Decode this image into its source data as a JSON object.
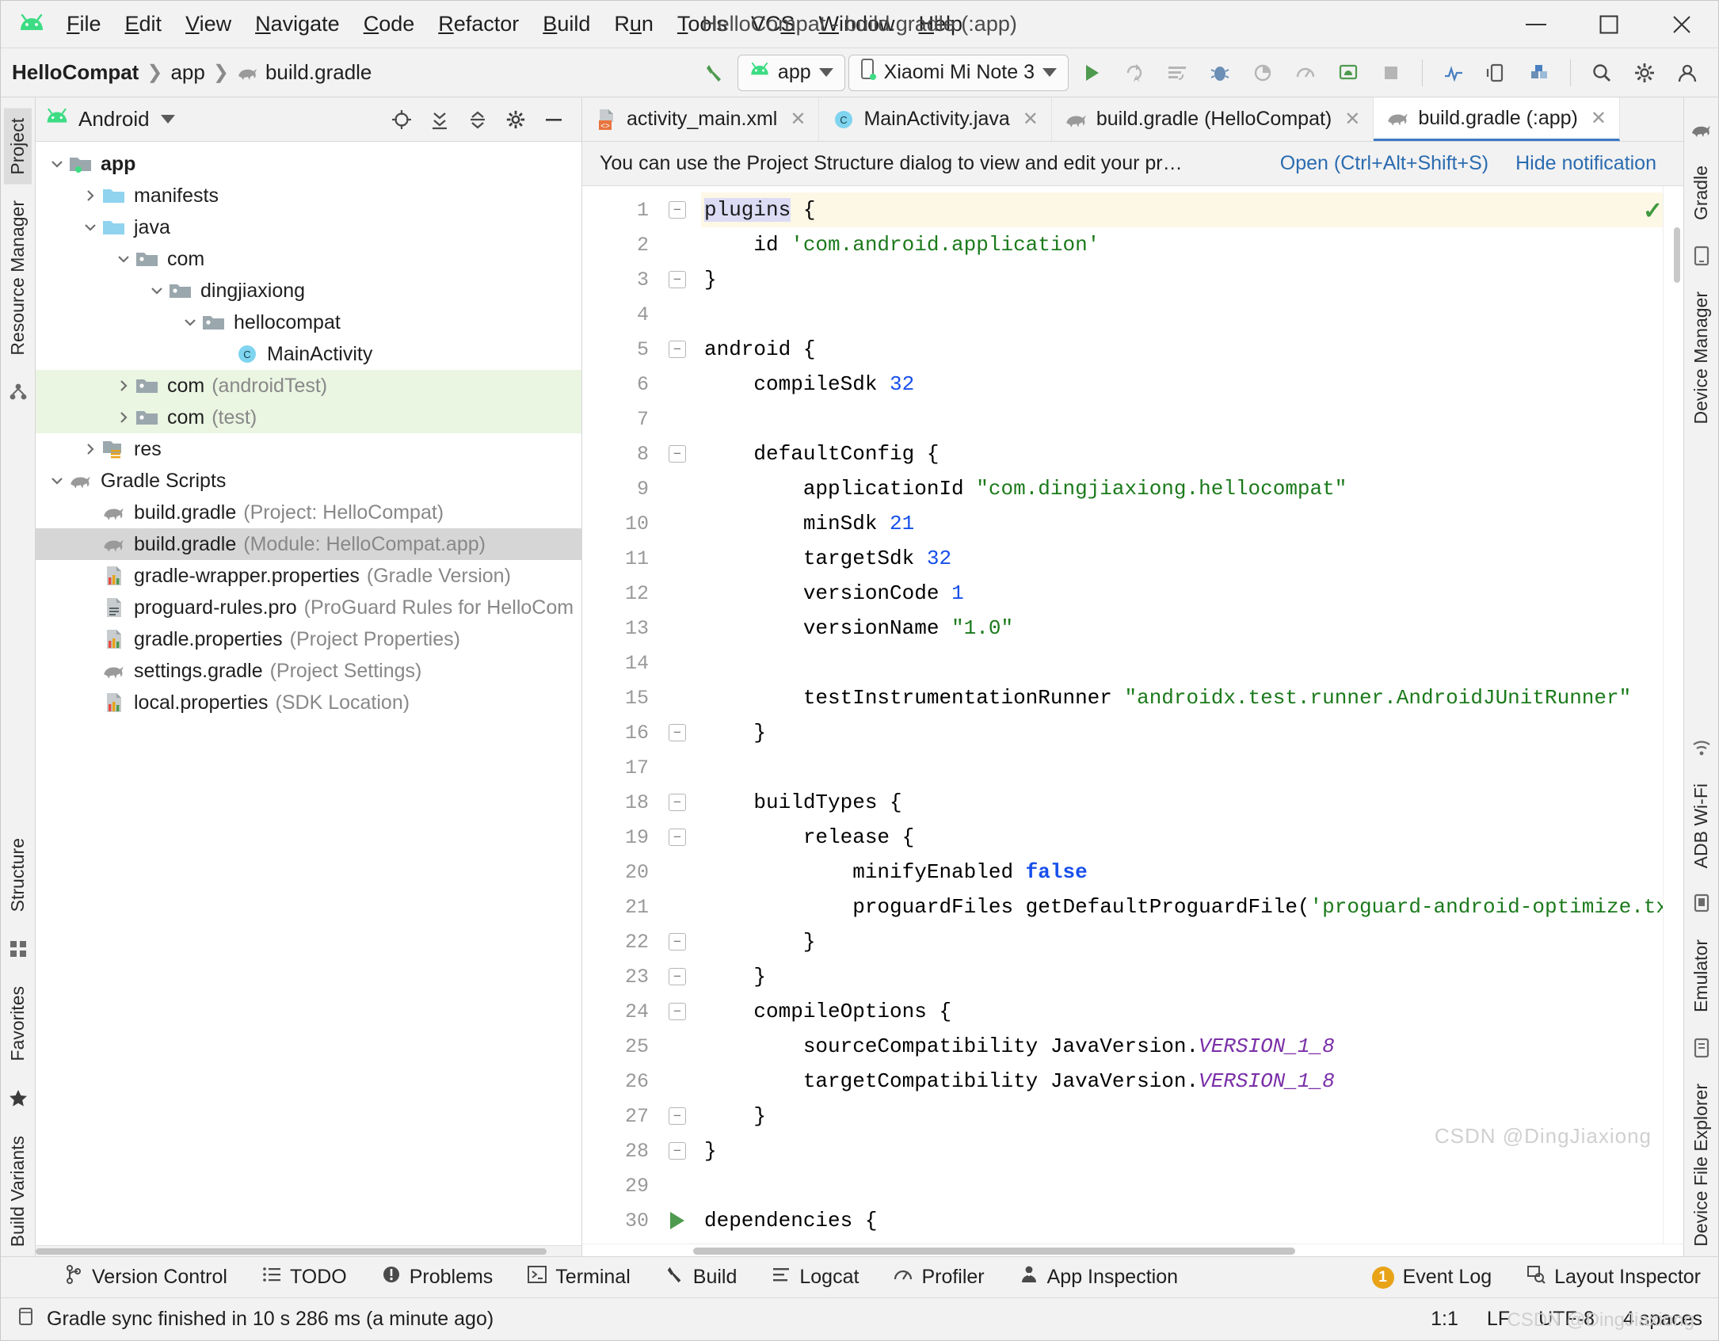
{
  "window": {
    "title": "HelloCompat - build.gradle (:app)",
    "minimize": "–",
    "maximize": "☐",
    "close": "✕"
  },
  "menu": {
    "items": [
      {
        "label": "File",
        "mnemonic": "F"
      },
      {
        "label": "Edit",
        "mnemonic": "E"
      },
      {
        "label": "View",
        "mnemonic": "V"
      },
      {
        "label": "Navigate",
        "mnemonic": "N"
      },
      {
        "label": "Code",
        "mnemonic": "C"
      },
      {
        "label": "Refactor",
        "mnemonic": "R"
      },
      {
        "label": "Build",
        "mnemonic": "B"
      },
      {
        "label": "Run",
        "mnemonic": "u"
      },
      {
        "label": "Tools",
        "mnemonic": "T"
      },
      {
        "label": "VCS",
        "mnemonic": "S"
      },
      {
        "label": "Window",
        "mnemonic": "W"
      },
      {
        "label": "Help",
        "mnemonic": "H"
      }
    ]
  },
  "navbar": {
    "breadcrumb": [
      "HelloCompat",
      "app",
      "build.gradle"
    ],
    "run_config": "app",
    "device": "Xiaomi Mi Note 3",
    "icons": [
      "build-hammer-icon",
      "run-icon",
      "rerun-icon",
      "sync-icon",
      "debug-icon",
      "profile-icon",
      "gauge-icon",
      "avd-manager-icon",
      "stop-icon",
      "device-mirror-icon",
      "layout-inspector-icon",
      "sdk-manager-icon",
      "search-icon",
      "settings-icon",
      "account-icon"
    ]
  },
  "left_strip": {
    "tabs": [
      "Project",
      "Resource Manager",
      "Structure",
      "Favorites",
      "Build Variants"
    ],
    "active_tab": "Project"
  },
  "right_strip": {
    "tabs": [
      "Gradle",
      "Device Manager",
      "ADB Wi-Fi",
      "Emulator",
      "Device File Explorer"
    ]
  },
  "project_panel": {
    "view_selector": "Android",
    "actions": [
      "locate-icon",
      "expand-all-icon",
      "collapse-all-icon",
      "gear-icon",
      "hide-icon"
    ],
    "tree": [
      {
        "depth": 0,
        "arrow": "down",
        "icon": "module-folder",
        "label": "app",
        "sub": "",
        "bold": true,
        "state": "normal"
      },
      {
        "depth": 1,
        "arrow": "right",
        "icon": "folder-blue",
        "label": "manifests",
        "sub": "",
        "bold": false,
        "state": "normal"
      },
      {
        "depth": 1,
        "arrow": "down",
        "icon": "folder-blue",
        "label": "java",
        "sub": "",
        "bold": false,
        "state": "normal"
      },
      {
        "depth": 2,
        "arrow": "down",
        "icon": "package",
        "label": "com",
        "sub": "",
        "bold": false,
        "state": "normal"
      },
      {
        "depth": 3,
        "arrow": "down",
        "icon": "package",
        "label": "dingjiaxiong",
        "sub": "",
        "bold": false,
        "state": "normal"
      },
      {
        "depth": 4,
        "arrow": "down",
        "icon": "package",
        "label": "hellocompat",
        "sub": "",
        "bold": false,
        "state": "normal"
      },
      {
        "depth": 5,
        "arrow": "none",
        "icon": "class",
        "label": "MainActivity",
        "sub": "",
        "bold": false,
        "state": "normal"
      },
      {
        "depth": 2,
        "arrow": "right",
        "icon": "package",
        "label": "com",
        "sub": "(androidTest)",
        "bold": false,
        "state": "green"
      },
      {
        "depth": 2,
        "arrow": "right",
        "icon": "package",
        "label": "com",
        "sub": "(test)",
        "bold": false,
        "state": "green"
      },
      {
        "depth": 1,
        "arrow": "right",
        "icon": "res-folder",
        "label": "res",
        "sub": "",
        "bold": false,
        "state": "normal"
      },
      {
        "depth": 0,
        "arrow": "down",
        "icon": "gradle",
        "label": "Gradle Scripts",
        "sub": "",
        "bold": false,
        "state": "normal"
      },
      {
        "depth": 1,
        "arrow": "none",
        "icon": "gradle",
        "label": "build.gradle",
        "sub": "(Project: HelloCompat)",
        "bold": false,
        "state": "normal"
      },
      {
        "depth": 1,
        "arrow": "none",
        "icon": "gradle",
        "label": "build.gradle",
        "sub": "(Module: HelloCompat.app)",
        "bold": false,
        "state": "selected"
      },
      {
        "depth": 1,
        "arrow": "none",
        "icon": "properties",
        "label": "gradle-wrapper.properties",
        "sub": "(Gradle Version)",
        "bold": false,
        "state": "normal"
      },
      {
        "depth": 1,
        "arrow": "none",
        "icon": "textfile",
        "label": "proguard-rules.pro",
        "sub": "(ProGuard Rules for HelloCom",
        "bold": false,
        "state": "normal"
      },
      {
        "depth": 1,
        "arrow": "none",
        "icon": "properties",
        "label": "gradle.properties",
        "sub": "(Project Properties)",
        "bold": false,
        "state": "normal"
      },
      {
        "depth": 1,
        "arrow": "none",
        "icon": "gradle",
        "label": "settings.gradle",
        "sub": "(Project Settings)",
        "bold": false,
        "state": "normal"
      },
      {
        "depth": 1,
        "arrow": "none",
        "icon": "properties",
        "label": "local.properties",
        "sub": "(SDK Location)",
        "bold": false,
        "state": "normal"
      }
    ]
  },
  "editor": {
    "tabs": [
      {
        "label": "activity_main.xml",
        "icon": "xml-layout-icon",
        "active": false,
        "closable": true
      },
      {
        "label": "MainActivity.java",
        "icon": "java-class-icon",
        "active": false,
        "closable": true
      },
      {
        "label": "build.gradle (HelloCompat)",
        "icon": "gradle-icon",
        "active": false,
        "closable": true
      },
      {
        "label": "build.gradle (:app)",
        "icon": "gradle-icon",
        "active": true,
        "closable": true
      }
    ],
    "notification": {
      "text": "You can use the Project Structure dialog to view and edit your pr…",
      "open_link": "Open (Ctrl+Alt+Shift+S)",
      "hide_link": "Hide notification"
    },
    "inspection_status": "✓",
    "watermark": "CSDN @DingJiaxiong",
    "lines": [
      {
        "n": 1,
        "mark": "fold-open",
        "hl": true,
        "tokens": [
          {
            "t": "plugins",
            "c": "cursor-word"
          },
          {
            "t": " {",
            "c": "kw"
          }
        ]
      },
      {
        "n": 2,
        "mark": "bulb",
        "hl": false,
        "tokens": [
          {
            "t": "    id ",
            "c": "kw"
          },
          {
            "t": "'com.android.application'",
            "c": "str"
          }
        ]
      },
      {
        "n": 3,
        "mark": "fold-close",
        "hl": false,
        "tokens": [
          {
            "t": "}",
            "c": "kw"
          }
        ]
      },
      {
        "n": 4,
        "mark": "",
        "hl": false,
        "tokens": []
      },
      {
        "n": 5,
        "mark": "fold-open",
        "hl": false,
        "tokens": [
          {
            "t": "android {",
            "c": "kw"
          }
        ]
      },
      {
        "n": 6,
        "mark": "",
        "hl": false,
        "tokens": [
          {
            "t": "    compileSdk ",
            "c": "kw"
          },
          {
            "t": "32",
            "c": "num"
          }
        ]
      },
      {
        "n": 7,
        "mark": "",
        "hl": false,
        "tokens": []
      },
      {
        "n": 8,
        "mark": "fold-open",
        "hl": false,
        "tokens": [
          {
            "t": "    defaultConfig {",
            "c": "kw"
          }
        ]
      },
      {
        "n": 9,
        "mark": "",
        "hl": false,
        "tokens": [
          {
            "t": "        applicationId ",
            "c": "kw"
          },
          {
            "t": "\"com.dingjiaxiong.hellocompat\"",
            "c": "str"
          }
        ]
      },
      {
        "n": 10,
        "mark": "",
        "hl": false,
        "tokens": [
          {
            "t": "        minSdk ",
            "c": "kw"
          },
          {
            "t": "21",
            "c": "num"
          }
        ]
      },
      {
        "n": 11,
        "mark": "",
        "hl": false,
        "tokens": [
          {
            "t": "        targetSdk ",
            "c": "kw"
          },
          {
            "t": "32",
            "c": "num"
          }
        ]
      },
      {
        "n": 12,
        "mark": "",
        "hl": false,
        "tokens": [
          {
            "t": "        versionCode ",
            "c": "kw"
          },
          {
            "t": "1",
            "c": "num"
          }
        ]
      },
      {
        "n": 13,
        "mark": "",
        "hl": false,
        "tokens": [
          {
            "t": "        versionName ",
            "c": "kw"
          },
          {
            "t": "\"1.0\"",
            "c": "str"
          }
        ]
      },
      {
        "n": 14,
        "mark": "",
        "hl": false,
        "tokens": []
      },
      {
        "n": 15,
        "mark": "",
        "hl": false,
        "tokens": [
          {
            "t": "        testInstrumentationRunner ",
            "c": "kw"
          },
          {
            "t": "\"androidx.test.runner.AndroidJUnitRunner\"",
            "c": "str"
          }
        ]
      },
      {
        "n": 16,
        "mark": "fold-close",
        "hl": false,
        "tokens": [
          {
            "t": "    }",
            "c": "kw"
          }
        ]
      },
      {
        "n": 17,
        "mark": "",
        "hl": false,
        "tokens": []
      },
      {
        "n": 18,
        "mark": "fold-open",
        "hl": false,
        "tokens": [
          {
            "t": "    buildTypes {",
            "c": "kw"
          }
        ]
      },
      {
        "n": 19,
        "mark": "fold-open",
        "hl": false,
        "tokens": [
          {
            "t": "        release {",
            "c": "kw"
          }
        ]
      },
      {
        "n": 20,
        "mark": "",
        "hl": false,
        "tokens": [
          {
            "t": "            minifyEnabled ",
            "c": "kw"
          },
          {
            "t": "false",
            "c": "bool"
          }
        ]
      },
      {
        "n": 21,
        "mark": "",
        "hl": false,
        "tokens": [
          {
            "t": "            proguardFiles getDefaultProguardFile(",
            "c": "kw"
          },
          {
            "t": "'proguard-android-optimize.txt",
            "c": "str"
          }
        ]
      },
      {
        "n": 22,
        "mark": "fold-close",
        "hl": false,
        "tokens": [
          {
            "t": "        }",
            "c": "kw"
          }
        ]
      },
      {
        "n": 23,
        "mark": "fold-close",
        "hl": false,
        "tokens": [
          {
            "t": "    }",
            "c": "kw"
          }
        ]
      },
      {
        "n": 24,
        "mark": "fold-open",
        "hl": false,
        "tokens": [
          {
            "t": "    compileOptions {",
            "c": "kw"
          }
        ]
      },
      {
        "n": 25,
        "mark": "",
        "hl": false,
        "tokens": [
          {
            "t": "        sourceCompatibility JavaVersion.",
            "c": "kw"
          },
          {
            "t": "VERSION_1_8",
            "c": "italic"
          }
        ]
      },
      {
        "n": 26,
        "mark": "",
        "hl": false,
        "tokens": [
          {
            "t": "        targetCompatibility JavaVersion.",
            "c": "kw"
          },
          {
            "t": "VERSION_1_8",
            "c": "italic"
          }
        ]
      },
      {
        "n": 27,
        "mark": "fold-close",
        "hl": false,
        "tokens": [
          {
            "t": "    }",
            "c": "kw"
          }
        ]
      },
      {
        "n": 28,
        "mark": "fold-close",
        "hl": false,
        "tokens": [
          {
            "t": "}",
            "c": "kw"
          }
        ]
      },
      {
        "n": 29,
        "mark": "",
        "hl": false,
        "tokens": []
      },
      {
        "n": 30,
        "mark": "run",
        "hl": false,
        "tokens": [
          {
            "t": "dependencies {",
            "c": "kw"
          }
        ]
      }
    ]
  },
  "tool_windows": {
    "left": [
      {
        "label": "Version Control",
        "icon": "branch-icon"
      },
      {
        "label": "TODO",
        "icon": "list-icon"
      },
      {
        "label": "Problems",
        "icon": "error-icon"
      },
      {
        "label": "Terminal",
        "icon": "terminal-icon"
      },
      {
        "label": "Build",
        "icon": "hammer-icon"
      },
      {
        "label": "Logcat",
        "icon": "logcat-icon"
      },
      {
        "label": "Profiler",
        "icon": "profiler-icon"
      },
      {
        "label": "App Inspection",
        "icon": "inspection-icon"
      }
    ],
    "right": [
      {
        "label": "Event Log",
        "icon": "event-badge",
        "badge": "1"
      },
      {
        "label": "Layout Inspector",
        "icon": "layout-inspector-icon"
      }
    ]
  },
  "statusbar": {
    "message": "Gradle sync finished in 10 s 286 ms (a minute ago)",
    "caret": "1:1",
    "line_sep": "LF",
    "encoding": "UTF-8",
    "indent": "4 spaces",
    "watermark": "CSDN @DingJiaxiong"
  },
  "colors": {
    "accent": "#3c78c8",
    "green": "#4e9a4e",
    "string": "#1b7a1b",
    "number": "#1750eb",
    "selection": "#d6d6d6",
    "test_row": "#eaf5e2",
    "highlight_line": "#fdf8e6",
    "badge": "#e8a317"
  }
}
